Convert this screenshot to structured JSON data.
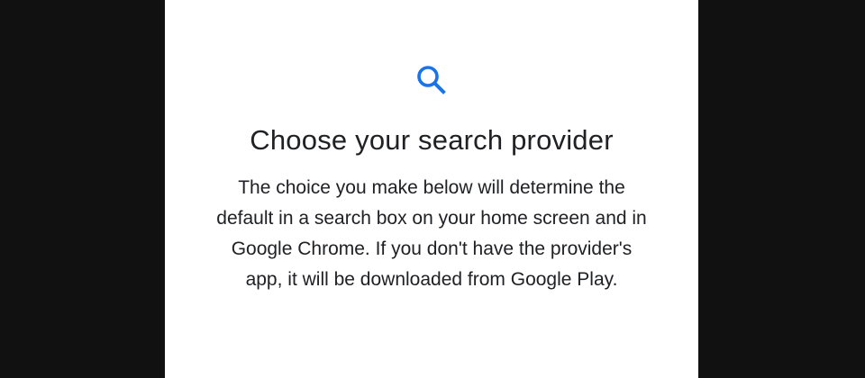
{
  "dialog": {
    "icon": "search-icon",
    "accent_color": "#1a73e8",
    "title": "Choose your search provider",
    "description_lines": [
      "The choice you make below will determine the",
      "default in a search box on your home screen and in",
      "Google Chrome. If you don't have the provider's",
      "app, it will be downloaded from Google Play."
    ]
  }
}
